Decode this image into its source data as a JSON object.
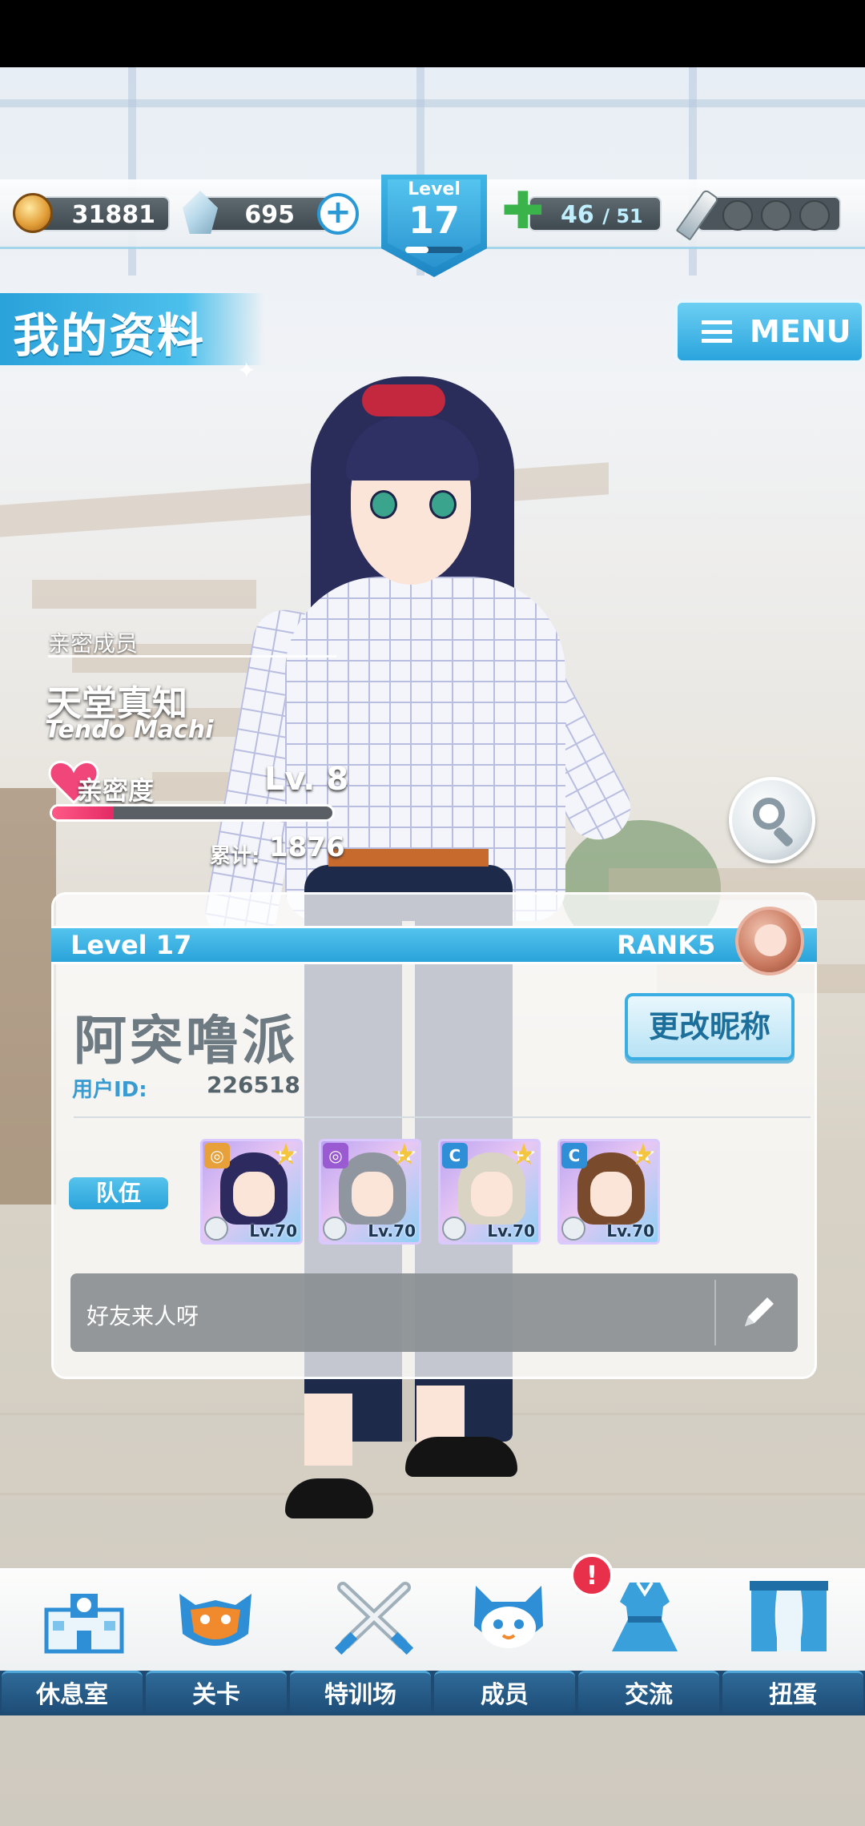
{
  "header": {
    "coins": "31881",
    "gems": "695",
    "level_label": "Level",
    "level": "17",
    "stamina_current": "46",
    "stamina_max": "/ 51",
    "stamina_sep_color": "#bfeeff"
  },
  "title": "我的资料",
  "menu_label": "MENU",
  "affinity": {
    "section_label": "亲密成员",
    "name": "天堂真知",
    "name_roman": "Tendo Machi",
    "label": "亲密度",
    "level": "Lv. 8",
    "progress_fraction": 0.22,
    "total_label": "累计:",
    "total": "1876"
  },
  "profile": {
    "level_text": "Level  17",
    "rank": "RANK5",
    "nickname": "阿突噜派",
    "user_id_label": "用户ID:",
    "user_id": "226518",
    "rename_button": "更改昵称",
    "team_label": "队伍",
    "team": [
      {
        "type": "spiral-icon",
        "type_color": "#e8a13a",
        "stars": "+2",
        "level": "Lv.70",
        "hair": "#2c2a5f"
      },
      {
        "type": "spiral-icon",
        "type_color": "#9a5ad1",
        "stars": "+2",
        "level": "Lv.70",
        "hair": "#8f96a0"
      },
      {
        "type": "c",
        "type_color": "#2f8fd6",
        "stars": "+2",
        "level": "Lv.70",
        "hair": "#d9d3c4"
      },
      {
        "type": "c",
        "type_color": "#2f8fd6",
        "stars": "+2",
        "level": "Lv.70",
        "hair": "#7a4a2d"
      }
    ],
    "message": "好友来人呀"
  },
  "nav": {
    "items": [
      {
        "label": "休息室",
        "icon": "school-building-icon"
      },
      {
        "label": "关卡",
        "icon": "demon-mask-icon"
      },
      {
        "label": "特训场",
        "icon": "crossed-swords-icon"
      },
      {
        "label": "成员",
        "icon": "cat-head-icon"
      },
      {
        "label": "交流",
        "icon": "dress-icon"
      },
      {
        "label": "扭蛋",
        "icon": "curtain-stage-icon"
      }
    ],
    "notification_badge": "!"
  },
  "colors": {
    "accent": "#2aa3da",
    "nav_dark": "#1f4b72",
    "affinity_pink": "#e32a64"
  }
}
